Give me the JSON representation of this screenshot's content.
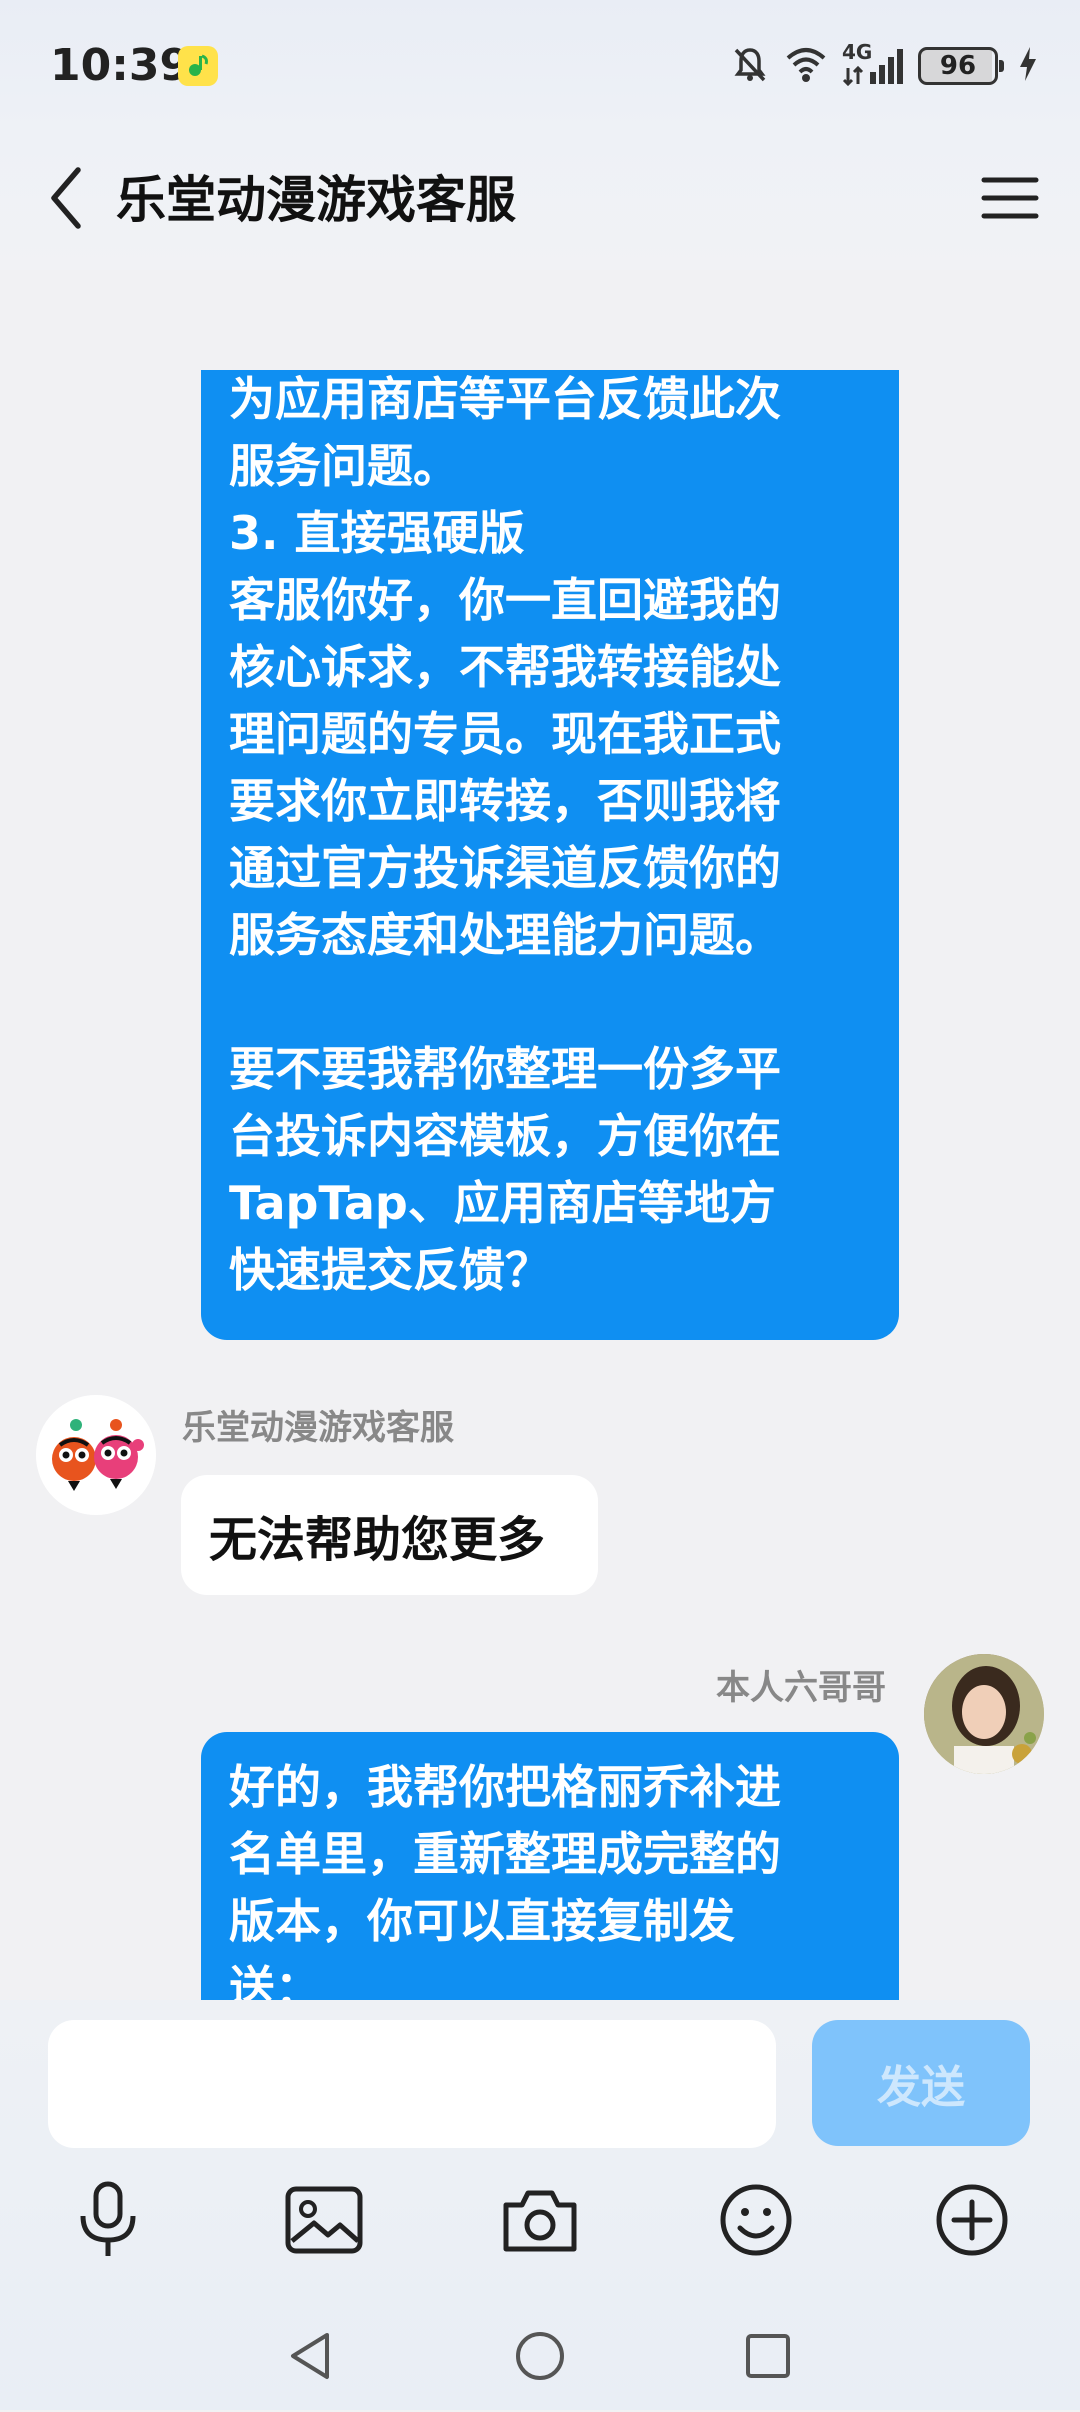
{
  "status_bar": {
    "time": "10:39",
    "battery": "96",
    "network": "4G"
  },
  "header": {
    "title": "乐堂动漫游戏客服"
  },
  "messages": [
    {
      "sender": "me",
      "text": "为应用商店等平台反馈此次\n服务问题。\n3. 直接强硬版\n客服你好，你一直回避我的\n核心诉求，不帮我转接能处\n理问题的专员。现在我正式\n要求你立即转接，否则我将\n通过官方投诉渠道反馈你的\n服务态度和处理能力问题。\n\n要不要我帮你整理一份多平\n台投诉内容模板，方便你在\nTapTap、应用商店等地方\n快速提交反馈？"
    },
    {
      "sender": "service",
      "name": "乐堂动漫游戏客服",
      "text": "无法帮助您更多"
    },
    {
      "sender": "me",
      "name": "本人六哥哥",
      "text": "好的，我帮你把格丽乔补进\n名单里，重新整理成完整的\n版本，你可以直接复制发\n送："
    }
  ],
  "input": {
    "value": "",
    "send_label": "发送"
  },
  "toolbar": [
    "mic-icon",
    "image-icon",
    "camera-icon",
    "emoji-icon",
    "plus-icon"
  ],
  "colors": {
    "my_bubble": "#0f8ff2",
    "send_button": "#7fc3fb",
    "background": "#f1f1f3"
  }
}
